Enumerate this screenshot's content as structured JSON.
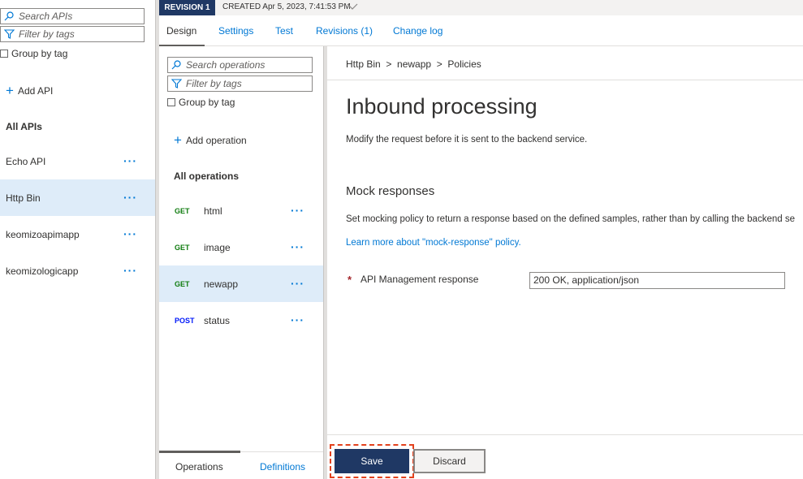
{
  "api_panel": {
    "search_placeholder": "Search APIs",
    "filter_placeholder": "Filter by tags",
    "group_by_tag": "Group by tag",
    "add_api": "Add API",
    "all_apis": "All APIs",
    "apis": [
      {
        "name": "Echo API",
        "selected": false
      },
      {
        "name": "Http Bin",
        "selected": true
      },
      {
        "name": "keomizoapimapp",
        "selected": false
      },
      {
        "name": "keomizologicapp",
        "selected": false
      }
    ]
  },
  "revision": {
    "badge": "REVISION 1",
    "created": "CREATED Apr 5, 2023, 7:41:53 PM"
  },
  "tabs": [
    "Design",
    "Settings",
    "Test",
    "Revisions (1)",
    "Change log"
  ],
  "operations_panel": {
    "search_placeholder": "Search operations",
    "filter_placeholder": "Filter by tags",
    "group_by_tag": "Group by tag",
    "add_operation": "Add operation",
    "all_operations": "All operations",
    "operations": [
      {
        "method": "GET",
        "name": "html",
        "selected": false
      },
      {
        "method": "GET",
        "name": "image",
        "selected": false
      },
      {
        "method": "GET",
        "name": "newapp",
        "selected": true
      },
      {
        "method": "POST",
        "name": "status",
        "selected": false
      }
    ],
    "bottom_tabs": [
      "Operations",
      "Definitions"
    ]
  },
  "detail": {
    "breadcrumb": "Http Bin  >  newapp  >  Policies",
    "title": "Inbound processing",
    "subtitle": "Modify the request before it is sent to the backend service.",
    "mock_heading": "Mock responses",
    "mock_description": "Set mocking policy to return a response based on the defined samples, rather than by calling the backend se",
    "mock_link": "Learn more about \"mock-response\" policy.",
    "required_marker": "*",
    "response_label": "API Management response",
    "response_value": "200 OK, application/json",
    "save": "Save",
    "discard": "Discard"
  },
  "icons": {
    "search": "search-icon",
    "filter": "filter-icon",
    "plus": "plus-icon",
    "ellipsis": "ellipsis-icon",
    "chevron": "chevron-down-icon"
  },
  "colors": {
    "accent": "#0078d4",
    "dark_navy": "#1f3864",
    "selected_bg": "#deecf9",
    "get": "#107c10",
    "post": "#0018f9",
    "highlight": "#e3411c"
  }
}
